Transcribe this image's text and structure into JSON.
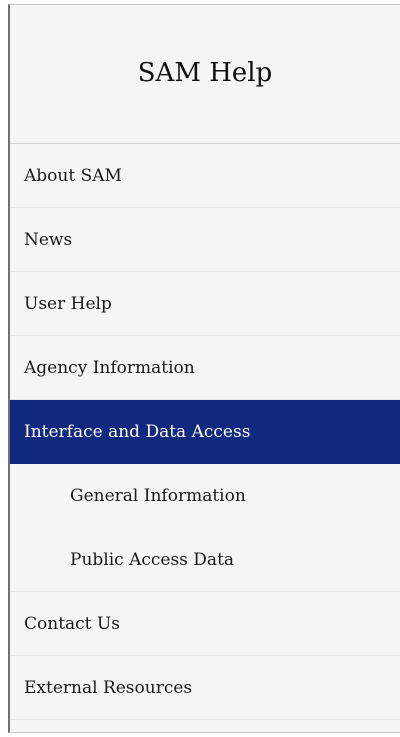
{
  "nav": {
    "title": "SAM Help",
    "items": [
      {
        "label": "About SAM"
      },
      {
        "label": "News"
      },
      {
        "label": "User Help"
      },
      {
        "label": "Agency Information"
      },
      {
        "label": "Interface and Data Access"
      },
      {
        "label": "General Information"
      },
      {
        "label": "Public Access Data"
      },
      {
        "label": "Contact Us"
      },
      {
        "label": "External Resources"
      }
    ]
  },
  "colors": {
    "active_bg": "#112a80",
    "active_text": "#ffffff",
    "panel_bg": "#f5f5f5"
  }
}
